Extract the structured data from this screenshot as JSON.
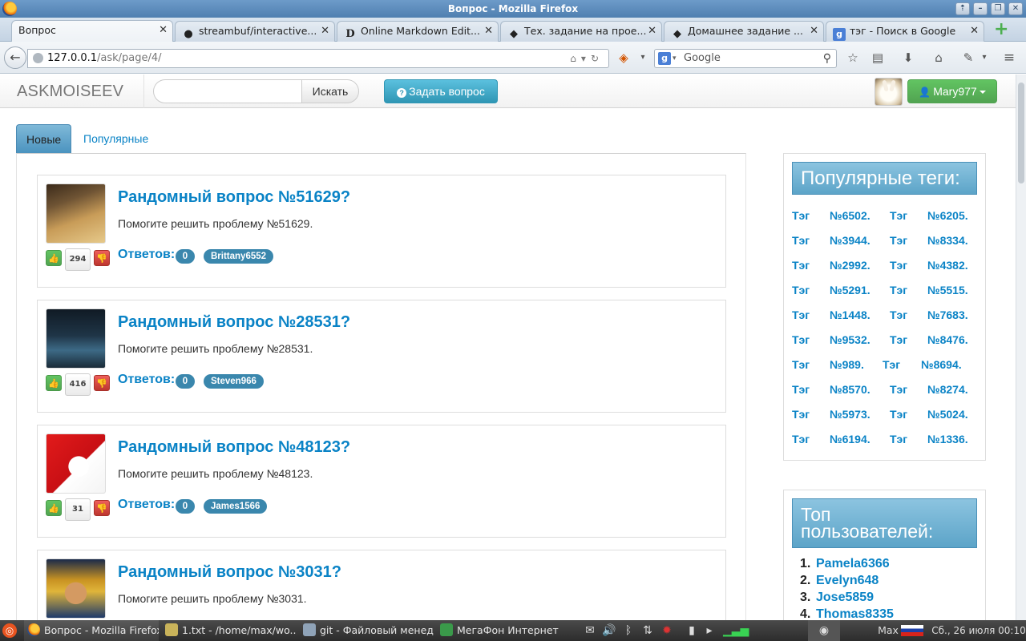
{
  "window": {
    "title": "Вопрос - Mozilla Firefox",
    "buttons": [
      "⇡",
      "–",
      "❐",
      "✕"
    ]
  },
  "tabs": [
    {
      "label": "Вопрос",
      "icon": "none",
      "active": true
    },
    {
      "label": "streambuf/interactive...",
      "icon": "github-icon"
    },
    {
      "label": "Online Markdown Edit...",
      "icon": "d-icon"
    },
    {
      "label": "Тех. задание на прое...",
      "icon": "diamond-icon"
    },
    {
      "label": "Домашнее задание ...",
      "icon": "diamond-icon"
    },
    {
      "label": "тэг - Поиск в Google",
      "icon": "google-icon"
    }
  ],
  "navbar": {
    "url_host": "127.0.0.1",
    "url_path": "/ask/page/4/",
    "search_placeholder": "Google"
  },
  "site": {
    "brand": "ASKMOISEEV",
    "search_button": "Искать",
    "ask_button": "Задать вопрос",
    "username": "Mary977"
  },
  "page_tabs": {
    "new": "Новые",
    "popular": "Популярные"
  },
  "answers_label": "Ответов:",
  "questions": [
    {
      "title": "Рандомный вопрос №51629?",
      "body": "Помогите решить проблему №51629.",
      "votes": "294",
      "answers": "0",
      "author": "Brittany6552"
    },
    {
      "title": "Рандомный вопрос №28531?",
      "body": "Помогите решить проблему №28531.",
      "votes": "416",
      "answers": "0",
      "author": "Steven966"
    },
    {
      "title": "Рандомный вопрос №48123?",
      "body": "Помогите решить проблему №48123.",
      "votes": "31",
      "answers": "0",
      "author": "James1566"
    },
    {
      "title": "Рандомный вопрос №3031?",
      "body": "Помогите решить проблему №3031.",
      "votes": "",
      "answers": "",
      "author": ""
    }
  ],
  "popular_tags": {
    "heading": "Популярные теги:",
    "rows": [
      [
        "Тэг",
        "№6502.",
        "Тэг",
        "№6205."
      ],
      [
        "Тэг",
        "№3944.",
        "Тэг",
        "№8334."
      ],
      [
        "Тэг",
        "№2992.",
        "Тэг",
        "№4382."
      ],
      [
        "Тэг",
        "№5291.",
        "Тэг",
        "№5515."
      ],
      [
        "Тэг",
        "№1448.",
        "Тэг",
        "№7683."
      ],
      [
        "Тэг",
        "№9532.",
        "Тэг",
        "№8476."
      ],
      [
        "Тэг",
        "№989.",
        "Тэг",
        "№8694."
      ],
      [
        "Тэг",
        "№8570.",
        "Тэг",
        "№8274."
      ],
      [
        "Тэг",
        "№5973.",
        "Тэг",
        "№5024."
      ],
      [
        "Тэг",
        "№6194.",
        "Тэг",
        "№1336."
      ]
    ]
  },
  "top_users": {
    "heading_line1": "Топ",
    "heading_line2": "пользователей:",
    "items": [
      {
        "num": "1.",
        "name": "Pamela6366"
      },
      {
        "num": "2.",
        "name": "Evelyn648"
      },
      {
        "num": "3.",
        "name": "Jose5859"
      },
      {
        "num": "4.",
        "name": "Thomas8335"
      }
    ]
  },
  "taskbar": {
    "items": [
      {
        "label": "Вопрос - Mozilla Firefox",
        "icon": "firefox-icon"
      },
      {
        "label": "1.txt - /home/max/wo...",
        "icon": "text-editor-icon"
      },
      {
        "label": "git - Файловый менед...",
        "icon": "folder-icon"
      },
      {
        "label": "МегаФон Интернет",
        "icon": "network-icon"
      }
    ],
    "user": "Max",
    "clock": "Сб., 26 июля  00:10"
  },
  "colors": {
    "link": "#0a83c6",
    "badge": "#3a87ad",
    "success": "#51a351",
    "danger": "#bd362f",
    "info": "#2f96b4"
  }
}
